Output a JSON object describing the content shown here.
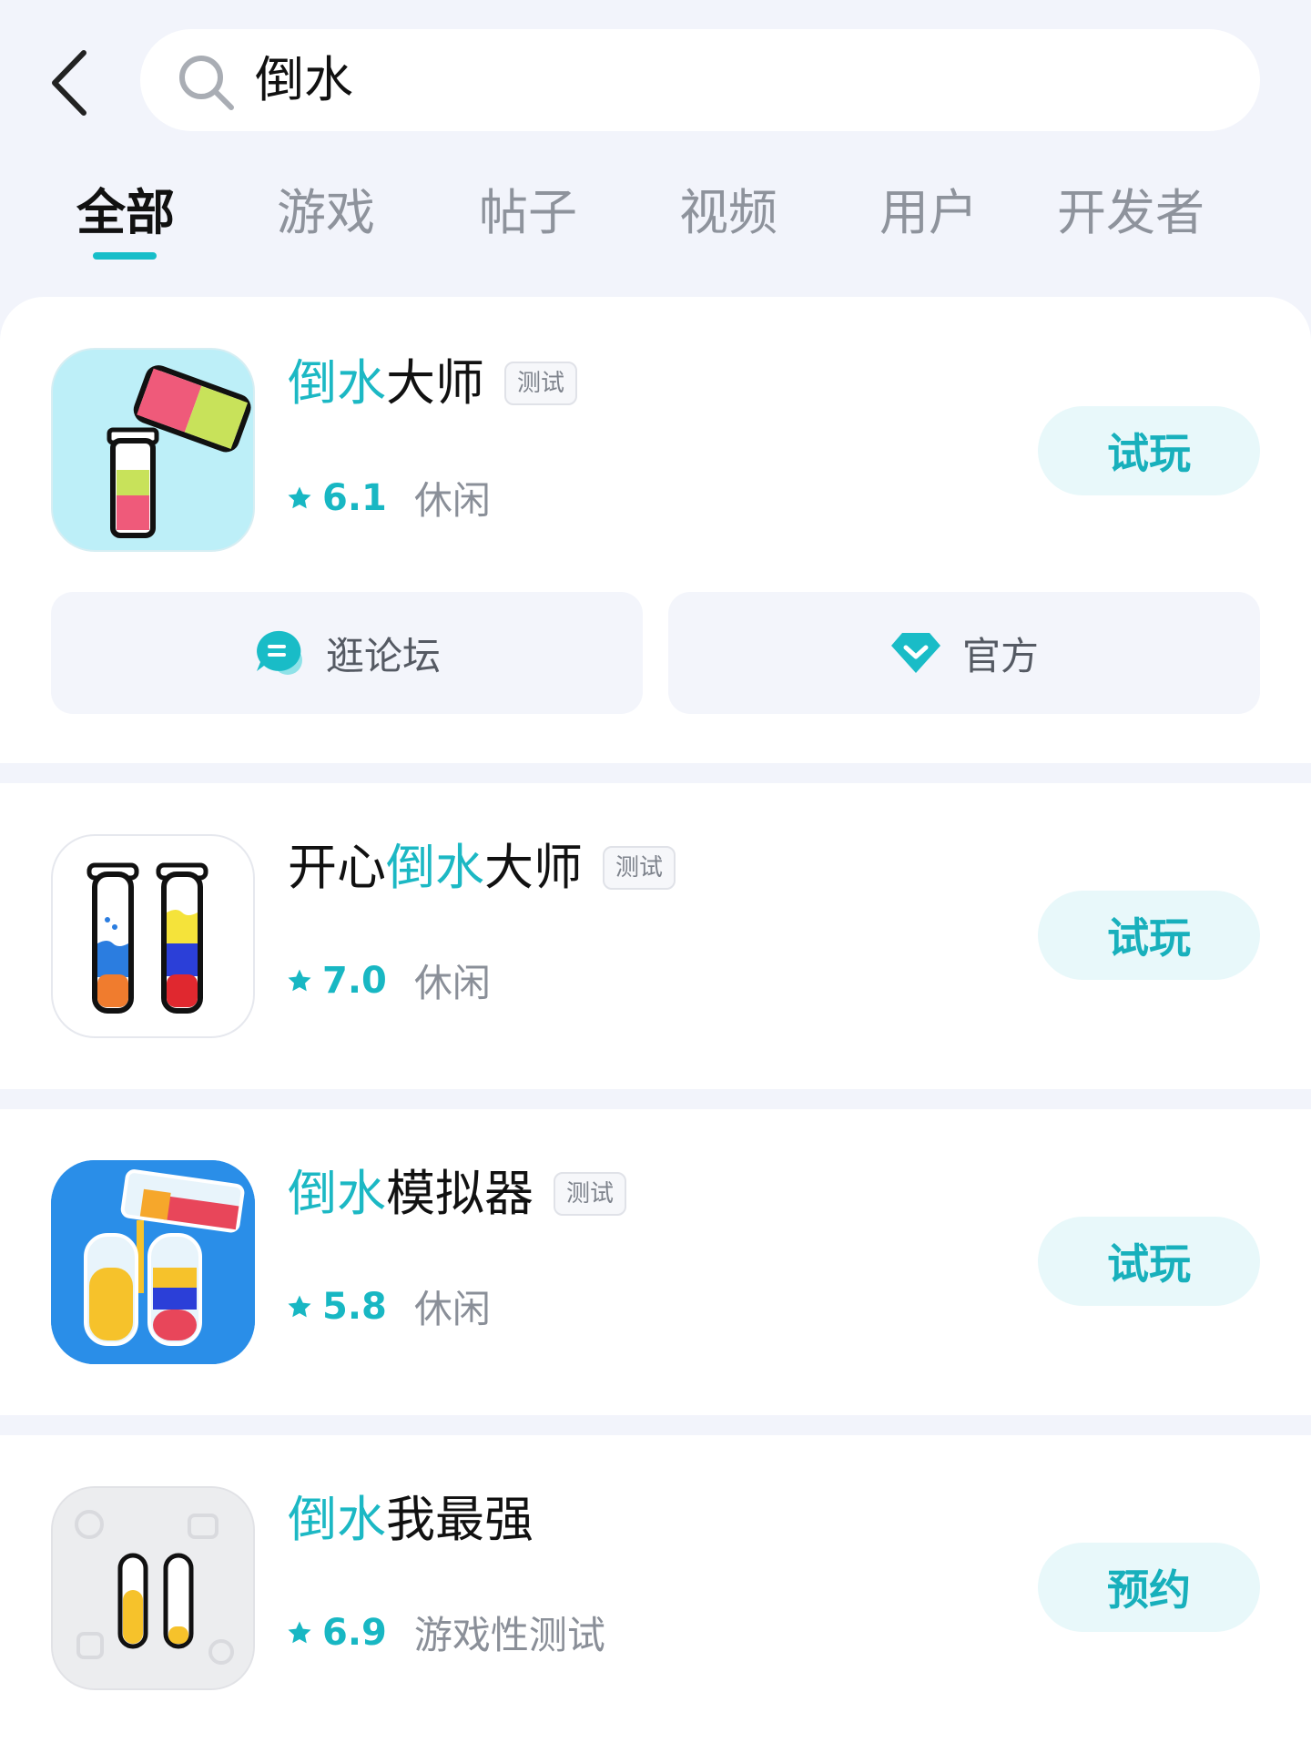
{
  "search": {
    "query": "倒水"
  },
  "tabs": [
    {
      "label": "全部",
      "active": true
    },
    {
      "label": "游戏",
      "active": false
    },
    {
      "label": "帖子",
      "active": false
    },
    {
      "label": "视频",
      "active": false
    },
    {
      "label": "用户",
      "active": false
    },
    {
      "label": "开发者",
      "active": false
    }
  ],
  "colors": {
    "accent": "#17bec9",
    "background": "#f2f4fb"
  },
  "results": [
    {
      "title_prefix": "",
      "title_highlight": "倒水",
      "title_suffix": "大师",
      "badge": "测试",
      "rating": "6.1",
      "category": "休闲",
      "action": "试玩",
      "icon": "pour-water-master-icon"
    },
    {
      "title_prefix": "开心",
      "title_highlight": "倒水",
      "title_suffix": "大师",
      "badge": "测试",
      "rating": "7.0",
      "category": "休闲",
      "action": "试玩",
      "icon": "happy-pour-water-icon"
    },
    {
      "title_prefix": "",
      "title_highlight": "倒水",
      "title_suffix": "模拟器",
      "badge": "测试",
      "rating": "5.8",
      "category": "休闲",
      "action": "试玩",
      "icon": "pour-water-simulator-icon"
    },
    {
      "title_prefix": "",
      "title_highlight": "倒水",
      "title_suffix": "我最强",
      "badge": "",
      "rating": "6.9",
      "category": "游戏性测试",
      "action": "预约",
      "icon": "pour-water-strongest-icon"
    }
  ],
  "first_card_links": {
    "forum": "逛论坛",
    "official": "官方"
  }
}
